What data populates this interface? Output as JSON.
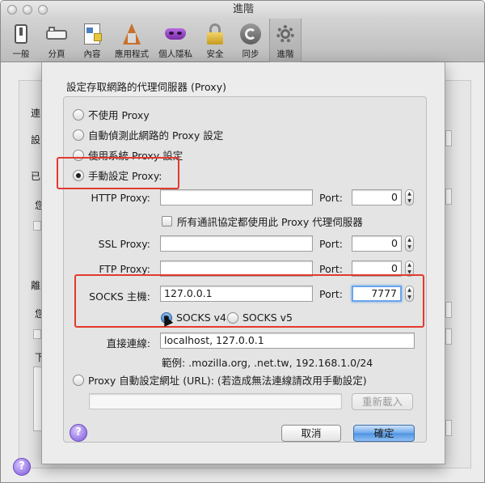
{
  "window": {
    "title": "進階"
  },
  "toolbar": {
    "items": [
      {
        "label": "一般",
        "icon": "switch-icon"
      },
      {
        "label": "分頁",
        "icon": "tabs-icon"
      },
      {
        "label": "內容",
        "icon": "document-icon"
      },
      {
        "label": "應用程式",
        "icon": "applications-icon"
      },
      {
        "label": "個人隱私",
        "icon": "mask-icon"
      },
      {
        "label": "安全",
        "icon": "lock-icon"
      },
      {
        "label": "同步",
        "icon": "sync-icon"
      },
      {
        "label": "進階",
        "icon": "gear-icon"
      }
    ],
    "active": "進階"
  },
  "background": {
    "labels": [
      "連",
      "設",
      "已",
      "您",
      "離",
      "您",
      "下"
    ]
  },
  "dialog": {
    "heading": "設定存取網路的代理伺服器 (Proxy)",
    "options": {
      "no_proxy": "不使用 Proxy",
      "auto_detect": "自動偵測此網路的 Proxy 設定",
      "system": "使用系統 Proxy 設定",
      "manual": "手動設定 Proxy:",
      "auto_url": "Proxy 自動設定網址 (URL): (若造成無法連線請改用手動設定)"
    },
    "selected_option": "manual",
    "http": {
      "label": "HTTP Proxy:",
      "host": "",
      "port_label": "Port:",
      "port": "0"
    },
    "same_for_all": "所有通訊協定都使用此 Proxy 代理伺服器",
    "ssl": {
      "label": "SSL Proxy:",
      "host": "",
      "port_label": "Port:",
      "port": "0"
    },
    "ftp": {
      "label": "FTP Proxy:",
      "host": "",
      "port_label": "Port:",
      "port": "0"
    },
    "socks": {
      "label": "SOCKS 主機:",
      "host": "127.0.0.1",
      "port_label": "Port:",
      "port": "7777",
      "v4": "SOCKS v4",
      "v5": "SOCKS v5",
      "selected_version": "v4"
    },
    "no_proxy_for": {
      "label": "直接連線:",
      "value": "localhost, 127.0.0.1",
      "example": "範例: .mozilla.org, .net.tw, 192.168.1.0/24"
    },
    "auto_url_value": "",
    "reload_label": "重新載入",
    "cancel_label": "取消",
    "ok_label": "確定",
    "help_label": "?"
  },
  "colors": {
    "highlight": "#e23a2e",
    "focus": "#6aa4ea",
    "primary_button": "#4f92e1"
  }
}
